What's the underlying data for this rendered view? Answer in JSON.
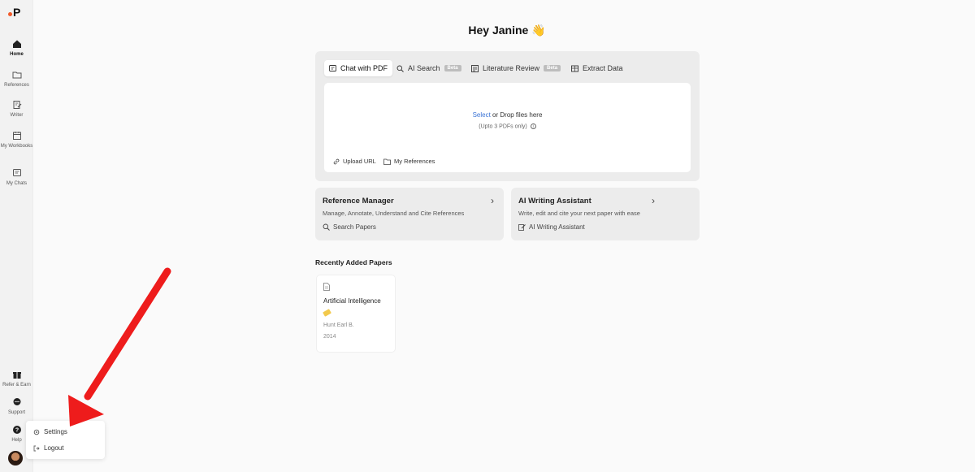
{
  "logo": "P",
  "sidebar": {
    "items": [
      {
        "label": "Home"
      },
      {
        "label": "References"
      },
      {
        "label": "Writer"
      },
      {
        "label": "My Workbooks"
      },
      {
        "label": "My Chats"
      },
      {
        "label": "Refer & Earn"
      },
      {
        "label": "Support"
      },
      {
        "label": "Help"
      }
    ]
  },
  "popup": {
    "settings": "Settings",
    "logout": "Logout"
  },
  "greeting": "Hey Janine 👋",
  "tabs": [
    {
      "label": "Chat with PDF"
    },
    {
      "label": "AI Search",
      "badge": "Beta"
    },
    {
      "label": "Literature Review",
      "badge": "Beta"
    },
    {
      "label": "Extract Data"
    }
  ],
  "dropzone": {
    "link": "Select",
    "text": " or Drop files here",
    "note": "(Upto 3 PDFs only)",
    "upload_url": "Upload URL",
    "my_references": "My References"
  },
  "cards": [
    {
      "title": "Reference Manager",
      "desc": "Manage, Annotate, Understand and Cite References",
      "action": "Search Papers"
    },
    {
      "title": "AI Writing Assistant",
      "desc": "Write, edit and cite your next paper with ease",
      "action": "AI Writing Assistant"
    }
  ],
  "recent": {
    "title": "Recently Added Papers",
    "papers": [
      {
        "title": "Artificial Intelligence",
        "author": "Hunt Earl B.",
        "year": "2014"
      }
    ]
  },
  "colors": {
    "accent_link": "#3b74d6",
    "logo_dot": "#f25a2a",
    "arrow": "#ee1c1c"
  }
}
